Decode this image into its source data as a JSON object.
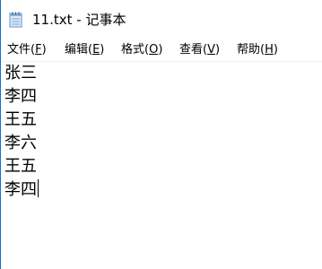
{
  "window": {
    "title": "11.txt - 记事本",
    "icon": "notepad-icon"
  },
  "menu": [
    {
      "label": "文件(",
      "mnemonic": "F",
      "suffix": ")"
    },
    {
      "label": "编辑(",
      "mnemonic": "E",
      "suffix": ")"
    },
    {
      "label": "格式(",
      "mnemonic": "O",
      "suffix": ")"
    },
    {
      "label": "查看(",
      "mnemonic": "V",
      "suffix": ")"
    },
    {
      "label": "帮助(",
      "mnemonic": "H",
      "suffix": ")"
    }
  ],
  "document": {
    "lines": [
      "张三",
      "李四",
      "王五",
      "李六",
      "王五",
      "李四"
    ]
  }
}
